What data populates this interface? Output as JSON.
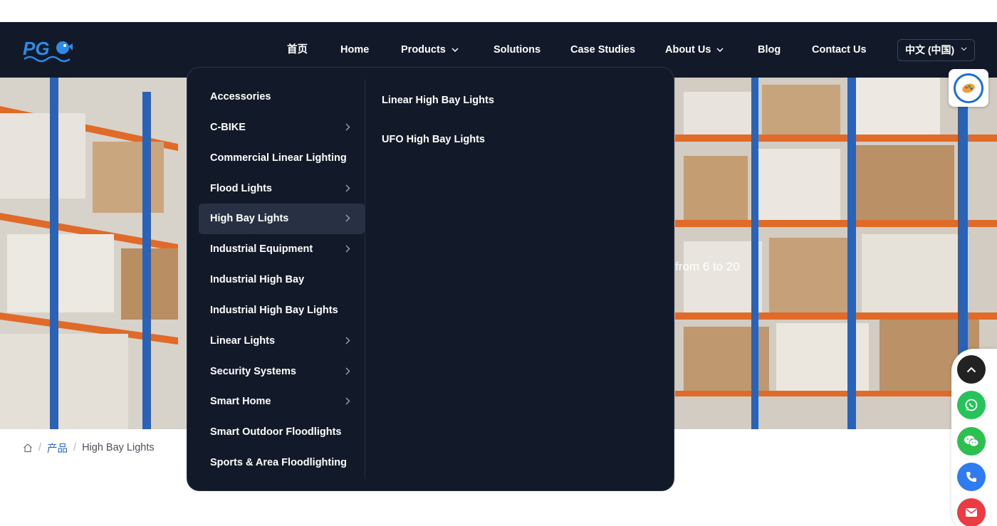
{
  "header": {
    "logo_text": "PG",
    "nav": [
      {
        "label": "首页",
        "has_dropdown": false
      },
      {
        "label": "Home",
        "has_dropdown": false
      },
      {
        "label": "Products",
        "has_dropdown": true
      },
      {
        "label": "Solutions",
        "has_dropdown": false
      },
      {
        "label": "Case Studies",
        "has_dropdown": false
      },
      {
        "label": "About Us",
        "has_dropdown": true
      },
      {
        "label": "Blog",
        "has_dropdown": false
      },
      {
        "label": "Contact Us",
        "has_dropdown": false
      }
    ],
    "language": "中文 (中国)"
  },
  "hero": {
    "visible_text": "from 6 to 20"
  },
  "products_menu": {
    "categories": [
      {
        "label": "Accessories",
        "has_submenu": false
      },
      {
        "label": "C-BIKE",
        "has_submenu": true
      },
      {
        "label": "Commercial Linear Lighting",
        "has_submenu": false
      },
      {
        "label": "Flood Lights",
        "has_submenu": true
      },
      {
        "label": "High Bay Lights",
        "has_submenu": true,
        "active": true
      },
      {
        "label": "Industrial Equipment",
        "has_submenu": true
      },
      {
        "label": "Industrial High Bay",
        "has_submenu": false
      },
      {
        "label": "Industrial High Bay Lights",
        "has_submenu": false
      },
      {
        "label": "Linear Lights",
        "has_submenu": true
      },
      {
        "label": "Security Systems",
        "has_submenu": true
      },
      {
        "label": "Smart Home",
        "has_submenu": true
      },
      {
        "label": "Smart Outdoor Floodlights",
        "has_submenu": false
      },
      {
        "label": "Sports & Area Floodlighting",
        "has_submenu": false
      }
    ],
    "subcategories": [
      "Linear High Bay Lights",
      "UFO High Bay Lights"
    ]
  },
  "breadcrumb": {
    "home_icon": "home-icon",
    "items": [
      "产品",
      "High Bay Lights"
    ]
  },
  "floating_contacts": [
    {
      "name": "back-to-top",
      "icon": "chevron-up-icon",
      "color": "#222222"
    },
    {
      "name": "whatsapp",
      "icon": "whatsapp-icon",
      "color": "#25c35a"
    },
    {
      "name": "wechat",
      "icon": "wechat-icon",
      "color": "#2cc04e"
    },
    {
      "name": "phone",
      "icon": "phone-icon",
      "color": "#2e7cf0"
    },
    {
      "name": "email",
      "icon": "mail-icon",
      "color": "#ea3c42"
    }
  ],
  "colors": {
    "nav_bg": "#121a29",
    "menu_active_bg": "#273143",
    "link": "#2466d6"
  }
}
